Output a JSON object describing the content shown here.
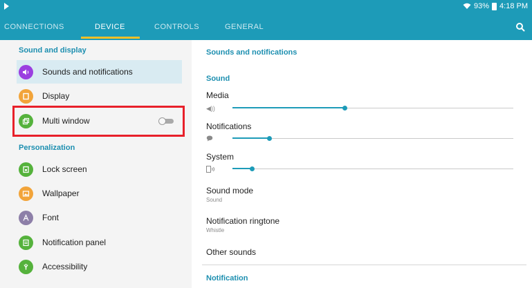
{
  "status_bar": {
    "battery_text": "93%",
    "time": "4:18 PM"
  },
  "tabs": [
    {
      "label": "CONNECTIONS",
      "active": false
    },
    {
      "label": "DEVICE",
      "active": true
    },
    {
      "label": "CONTROLS",
      "active": false
    },
    {
      "label": "GENERAL",
      "active": false
    }
  ],
  "left_pane": {
    "section_sound_display": "Sound and display",
    "section_personalization": "Personalization",
    "items": [
      {
        "label": "Sounds and notifications",
        "icon": "speaker-icon",
        "color": "#9b3fe0",
        "selected": true
      },
      {
        "label": "Display",
        "icon": "display-icon",
        "color": "#f2a43a"
      },
      {
        "label": "Multi window",
        "icon": "multi-window-icon",
        "color": "#55b23c",
        "toggle_on": false
      },
      {
        "label": "Lock screen",
        "icon": "lock-screen-icon",
        "color": "#55b23c"
      },
      {
        "label": "Wallpaper",
        "icon": "wallpaper-icon",
        "color": "#f2a43a"
      },
      {
        "label": "Font",
        "icon": "font-icon",
        "color": "#8d7fa8"
      },
      {
        "label": "Notification panel",
        "icon": "notification-panel-icon",
        "color": "#55b23c"
      },
      {
        "label": "Accessibility",
        "icon": "accessibility-icon",
        "color": "#55b23c"
      }
    ]
  },
  "right_pane": {
    "title": "Sounds and notifications",
    "section_sound": "Sound",
    "media_label": "Media",
    "media_level": 0.4,
    "notifications_label": "Notifications",
    "notifications_level": 0.13,
    "system_label": "System",
    "system_level": 0.07,
    "sound_mode_label": "Sound mode",
    "sound_mode_value": "Sound",
    "ringtone_label": "Notification ringtone",
    "ringtone_value": "Whistle",
    "other_sounds_label": "Other sounds",
    "section_notification": "Notification"
  },
  "colors": {
    "header_bg": "#1d9bb8",
    "accent": "#1d8fb0",
    "tab_indicator": "#f6c026",
    "highlight": "#e8202a"
  }
}
